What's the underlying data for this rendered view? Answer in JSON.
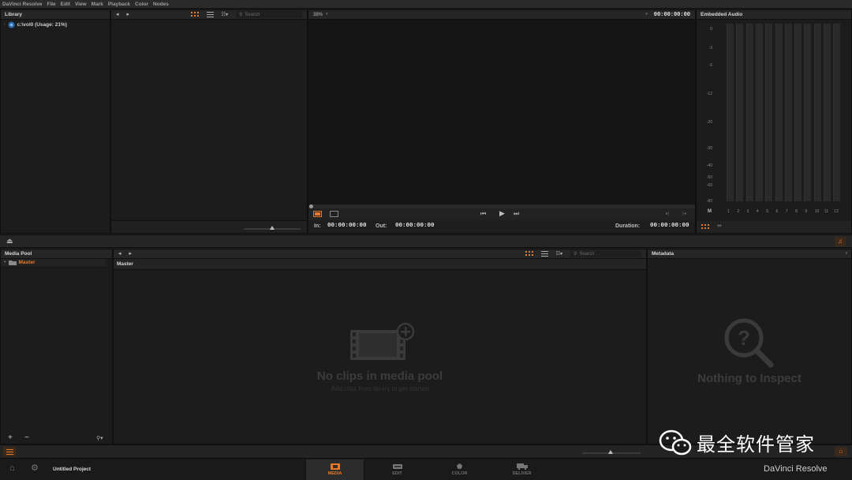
{
  "menubar": {
    "items": [
      "DaVinci Resolve",
      "File",
      "Edit",
      "View",
      "Mark",
      "Playback",
      "Color",
      "Nodes"
    ]
  },
  "library": {
    "title": "Library",
    "volume_label": "c:\\vol0 (Usage: 21%)"
  },
  "browser": {
    "search_placeholder": "Search"
  },
  "viewer": {
    "zoom": "38%",
    "timecode": "00:00:00:00",
    "in_label": "In:",
    "in_value": "00:00:00:00",
    "out_label": "Out:",
    "out_value": "00:00:00:00",
    "duration_label": "Duration:",
    "duration_value": "00:00:00:00"
  },
  "audio": {
    "title": "Embedded Audio",
    "scale": [
      "0",
      "-3",
      "-6",
      "-12",
      "-20",
      "-30",
      "-40",
      "-50",
      "-60",
      "-80"
    ],
    "channels": [
      "1",
      "2",
      "3",
      "4",
      "5",
      "6",
      "7",
      "8",
      "9",
      "10",
      "11",
      "12"
    ],
    "master_label": "M"
  },
  "media_pool": {
    "title": "Media Pool",
    "folder": "Master",
    "bin_title": "Master",
    "search_placeholder": "Search",
    "empty_title": "No clips in media pool",
    "empty_subtitle": "Add clips from library to get started"
  },
  "metadata": {
    "title": "Metadata",
    "empty_title": "Nothing to Inspect"
  },
  "footer": {
    "project_name": "Untitled Project",
    "tabs": [
      "MEDIA",
      "EDIT",
      "COLOR",
      "DELIVER"
    ],
    "brand": "DaVinci Resolve",
    "watermark": "最全软件管家"
  },
  "colors": {
    "accent": "#e8782a",
    "background": "#1c1c1c"
  }
}
